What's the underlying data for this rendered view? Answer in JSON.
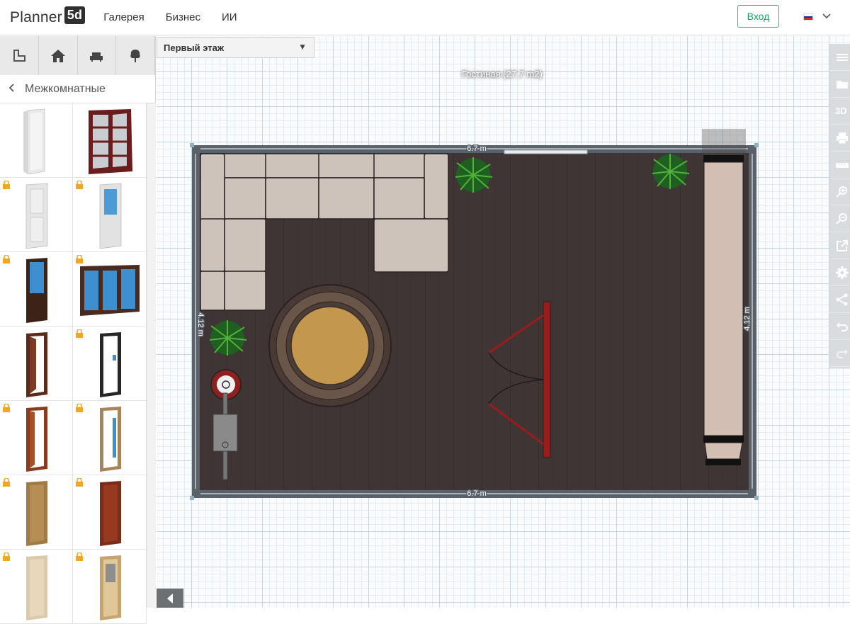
{
  "brand": {
    "name": "Planner",
    "badge": "5d"
  },
  "nav": [
    {
      "label": "Галерея"
    },
    {
      "label": "Бизнес"
    },
    {
      "label": "ИИ"
    }
  ],
  "header": {
    "login_label": "Вход",
    "language_flag_colors": [
      "#ffffff",
      "#0039a6",
      "#d52b1e"
    ]
  },
  "sidebar": {
    "tabs": [
      {
        "icon": "room-icon"
      },
      {
        "icon": "house-icon"
      },
      {
        "icon": "furniture-icon"
      },
      {
        "icon": "tree-icon"
      }
    ],
    "category_title": "Межкомнатные",
    "items": [
      {
        "kind": "white-door",
        "locked": false
      },
      {
        "kind": "double-wooden-door",
        "locked": false
      },
      {
        "kind": "white-panel-door",
        "locked": true
      },
      {
        "kind": "blue-glass-door",
        "locked": true
      },
      {
        "kind": "dark-door-blue-glass",
        "locked": true
      },
      {
        "kind": "wide-sliding-door",
        "locked": true
      },
      {
        "kind": "brown-open-door",
        "locked": false
      },
      {
        "kind": "black-glass-door",
        "locked": true
      },
      {
        "kind": "brown-frame-door",
        "locked": true
      },
      {
        "kind": "light-frame-door",
        "locked": true
      },
      {
        "kind": "oak-door",
        "locked": true
      },
      {
        "kind": "red-wood-door",
        "locked": true
      },
      {
        "kind": "beige-door",
        "locked": true
      },
      {
        "kind": "beige-glass-door",
        "locked": true
      }
    ]
  },
  "canvas": {
    "floor_select": "Первый этаж",
    "room_label": "Гостиная (27.7 m2)",
    "dimension_top": "6.7 m",
    "dimension_bottom": "6.7 m",
    "dimension_left": "4.12 m",
    "dimension_right": "4.12 m"
  },
  "right_toolbar": [
    {
      "icon": "menu-icon"
    },
    {
      "icon": "folder-icon"
    },
    {
      "label": "3D"
    },
    {
      "icon": "print-icon"
    },
    {
      "icon": "ruler-icon"
    },
    {
      "icon": "zoom-in-icon"
    },
    {
      "icon": "zoom-out-icon"
    },
    {
      "icon": "external-link-icon"
    },
    {
      "icon": "gear-icon"
    },
    {
      "icon": "share-icon"
    },
    {
      "icon": "undo-icon"
    },
    {
      "icon": "redo-icon"
    }
  ]
}
